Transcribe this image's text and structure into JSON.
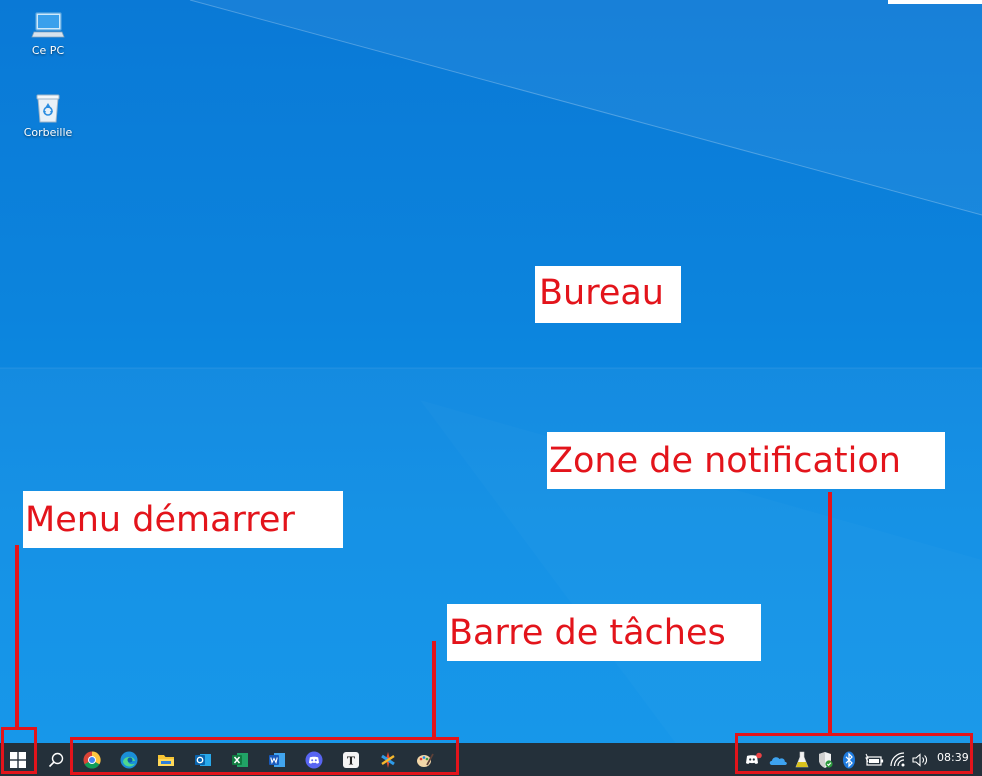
{
  "desktop": {
    "icons": [
      {
        "label": "Ce PC",
        "icon": "computer-icon"
      },
      {
        "label": "Corbeille",
        "icon": "recycle-bin-icon"
      }
    ]
  },
  "annotations": {
    "desktop": "Bureau",
    "notification_area": "Zone de notification",
    "start_menu": "Menu démarrer",
    "taskbar": "Barre de tâches"
  },
  "taskbar": {
    "pinned": [
      {
        "name": "chrome-icon"
      },
      {
        "name": "edge-icon"
      },
      {
        "name": "file-explorer-icon"
      },
      {
        "name": "outlook-icon"
      },
      {
        "name": "excel-icon"
      },
      {
        "name": "word-icon"
      },
      {
        "name": "discord-icon"
      },
      {
        "name": "typora-icon"
      },
      {
        "name": "sharex-icon"
      },
      {
        "name": "paint-icon"
      }
    ],
    "tray": [
      {
        "name": "discord-tray-icon"
      },
      {
        "name": "onedrive-icon"
      },
      {
        "name": "flask-icon"
      },
      {
        "name": "windows-security-icon"
      },
      {
        "name": "bluetooth-icon"
      },
      {
        "name": "battery-icon"
      },
      {
        "name": "wifi-icon"
      },
      {
        "name": "volume-icon"
      }
    ],
    "clock": "08:39"
  },
  "colors": {
    "annotation_red": "#e3141b",
    "desktop_blue": "#0c84dd",
    "taskbar": "#24303a"
  }
}
